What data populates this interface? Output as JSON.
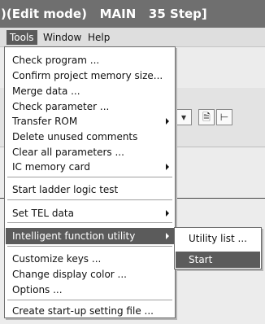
{
  "window": {
    "title": ")(Edit mode)   MAIN   35 Step]"
  },
  "menubar": {
    "items": [
      "Tools",
      "Window",
      "Help"
    ]
  },
  "tools_menu": {
    "items": [
      "Check program ...",
      "Confirm project memory size...",
      "Merge data ...",
      "Check parameter ...",
      "Transfer ROM",
      "Delete unused comments",
      "Clear all parameters ...",
      "IC memory card",
      "Start ladder logic test",
      "Set TEL data",
      "Intelligent function utility",
      "Customize keys ...",
      "Change display color ...",
      "Options ...",
      "Create start-up setting file ..."
    ]
  },
  "submenu": {
    "items": [
      "Utility list ...",
      "Start"
    ]
  },
  "colors": {
    "highlight": "#5b5b5b",
    "title_bg": "#6f6f6f"
  }
}
